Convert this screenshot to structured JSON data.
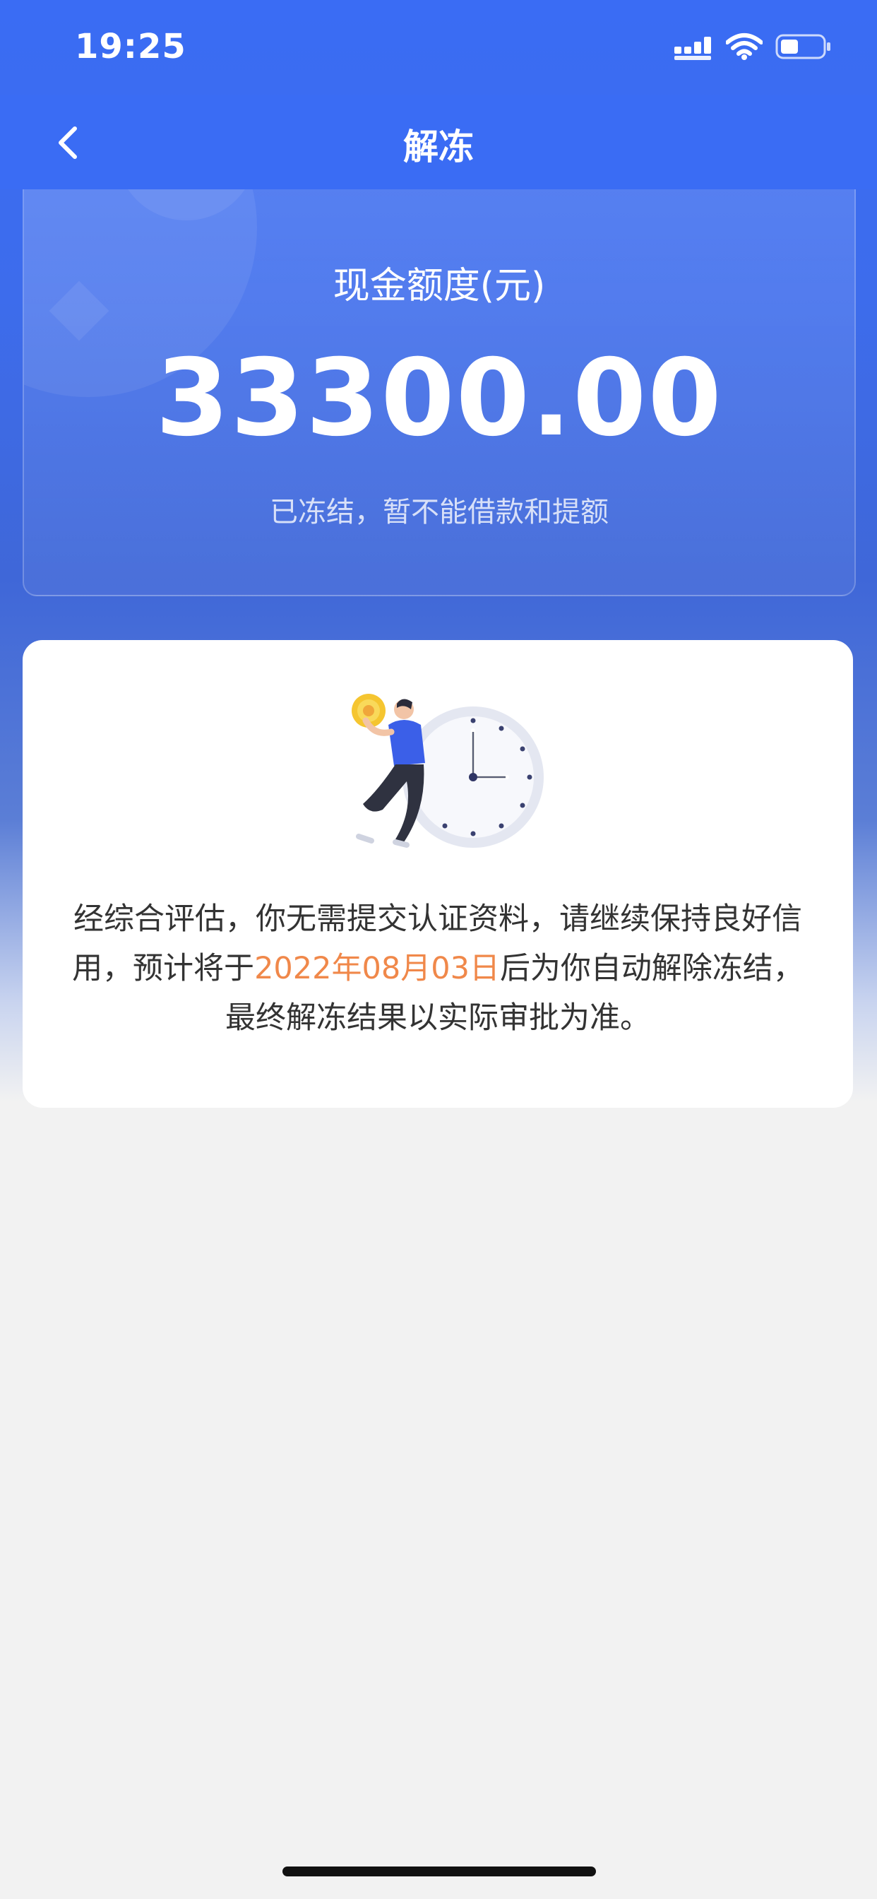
{
  "status_bar": {
    "time": "19:25"
  },
  "nav": {
    "title": "解冻"
  },
  "summary": {
    "label": "现金额度(元)",
    "amount": "33300.00",
    "note": "已冻结，暂不能借款和提额"
  },
  "info": {
    "text_before": "经综合评估，你无需提交认证资料，请继续保持良好信用，预计将于",
    "date": "2022年08月03日",
    "text_after": "后为你自动解除冻结，最终解冻结果以实际审批为准。"
  },
  "colors": {
    "primary": "#3a6cf4",
    "highlight": "#f0884a"
  },
  "icons": [
    "back-arrow-icon",
    "signal-icon",
    "wifi-icon",
    "battery-icon",
    "clock-illustration"
  ]
}
